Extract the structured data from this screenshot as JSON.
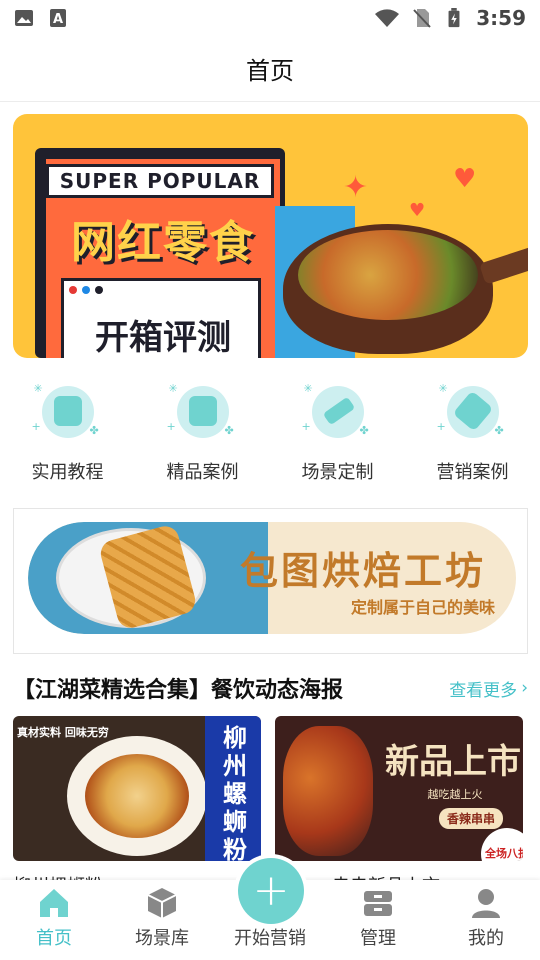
{
  "status_bar": {
    "time": "3:59",
    "icons": [
      "gallery-icon",
      "font-icon",
      "wifi-icon",
      "no-sim-icon",
      "battery-charging-icon"
    ]
  },
  "header": {
    "title": "首页"
  },
  "hero_banner": {
    "super_text": "SUPER POPULAR",
    "main_text": "网红零食",
    "sub_text": "开箱评测",
    "colors": {
      "background": "#ffc43a",
      "accent": "#ff6a3d",
      "dark": "#1f1f2b"
    }
  },
  "shortcuts": [
    {
      "label": "实用教程",
      "icon": "video-tutorial-icon"
    },
    {
      "label": "精品案例",
      "icon": "document-case-icon"
    },
    {
      "label": "场景定制",
      "icon": "pencil-ruler-icon"
    },
    {
      "label": "营销案例",
      "icon": "tag-icon"
    }
  ],
  "promo_banner": {
    "title": "包图烘焙工坊",
    "subtitle": "定制属于自己的美味"
  },
  "section": {
    "title": "【江湖菜精选合集】餐饮动态海报",
    "more_label": "查看更多"
  },
  "posters": [
    {
      "tag": "真材实料 回味无穷",
      "side_text": "柳州螺蛳粉",
      "caption": "柳州螺蛳粉"
    },
    {
      "title": "新品上市",
      "sub": "越吃越上火",
      "badge": "香辣串串",
      "corner": "全场八折",
      "caption": "串串新品上市"
    }
  ],
  "tabbar": {
    "items": [
      {
        "label": "首页",
        "icon": "home-icon",
        "active": true
      },
      {
        "label": "场景库",
        "icon": "box-icon",
        "active": false
      },
      {
        "label": "开始营销",
        "icon": "plus-icon",
        "active": false
      },
      {
        "label": "管理",
        "icon": "drawer-icon",
        "active": false
      },
      {
        "label": "我的",
        "icon": "user-icon",
        "active": false
      }
    ],
    "active_color": "#45c0c8"
  }
}
